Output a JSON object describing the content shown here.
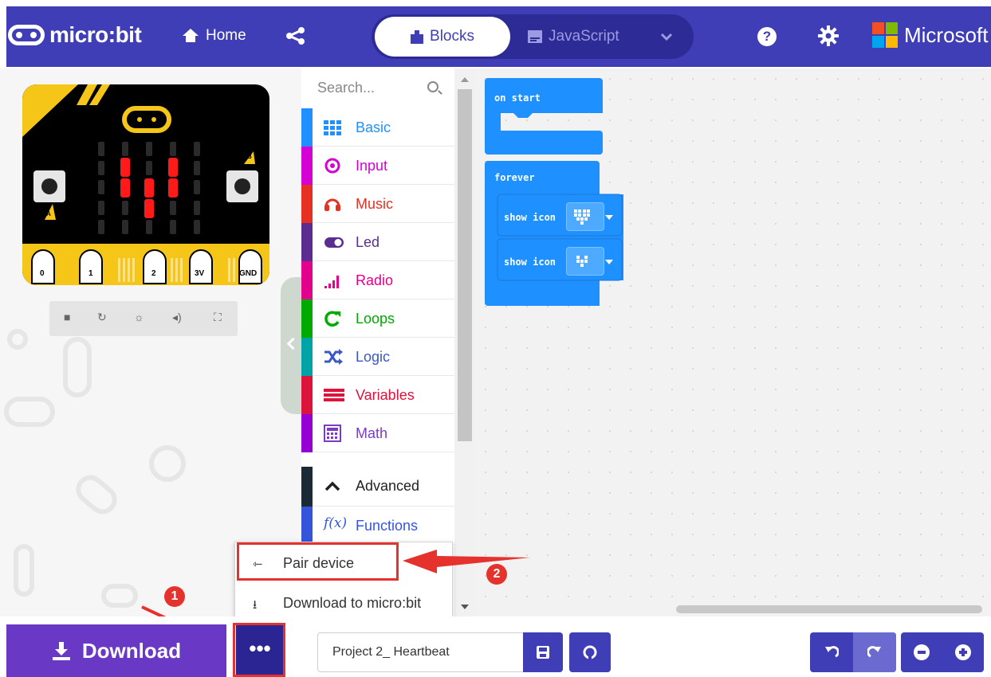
{
  "header": {
    "logo_text": "micro:bit",
    "home_label": "Home",
    "tabs": [
      {
        "label": "Blocks",
        "active": true
      },
      {
        "label": "JavaScript",
        "active": false
      }
    ],
    "brand_label": "Microsoft",
    "icons": [
      "microbit-logo-icon",
      "home-icon",
      "share-icon",
      "puzzle-icon",
      "code-icon",
      "chevron-down-icon",
      "help-icon",
      "gear-icon",
      "microsoft-logo-icon"
    ]
  },
  "simulator": {
    "pins": [
      "0",
      "1",
      "2",
      "3V",
      "GND"
    ],
    "button_a": "A",
    "button_b": "B",
    "controls": [
      "stop-icon",
      "restart-icon",
      "debug-icon",
      "mute-icon",
      "fullscreen-icon"
    ]
  },
  "toolbox": {
    "search_placeholder": "Search...",
    "categories": [
      {
        "label": "Basic",
        "color": "#1e90ff",
        "icon": "grid-icon"
      },
      {
        "label": "Input",
        "color": "#d400d4",
        "icon": "target-icon"
      },
      {
        "label": "Music",
        "color": "#e63022",
        "icon": "headphones-icon"
      },
      {
        "label": "Led",
        "color": "#5c2d91",
        "icon": "toggle-icon"
      },
      {
        "label": "Radio",
        "color": "#e3008c",
        "icon": "signal-bars-icon"
      },
      {
        "label": "Loops",
        "color": "#00aa00",
        "icon": "refresh-icon"
      },
      {
        "label": "Logic",
        "color": "#00a4a6",
        "icon": "shuffle-icon"
      },
      {
        "label": "Variables",
        "color": "#dc143c",
        "icon": "list-icon"
      },
      {
        "label": "Math",
        "color": "#9400d3",
        "icon": "calculator-icon"
      },
      {
        "label": "Advanced",
        "color": "#222222",
        "icon": "chevron-up-icon"
      },
      {
        "label": "Functions",
        "color": "#3455db",
        "icon": "function-icon"
      }
    ]
  },
  "workspace": {
    "blocks": {
      "on_start": "on start",
      "forever": "forever",
      "show_icon_1": "show icon",
      "show_icon_2": "show icon"
    }
  },
  "popup": {
    "items": [
      {
        "label": "Pair device",
        "icon": "usb-icon"
      },
      {
        "label": "Download to micro:bit",
        "icon": "download-icon"
      }
    ],
    "step_badges": [
      "1",
      "2"
    ]
  },
  "bottom": {
    "download_label": "Download",
    "more_label": "•••",
    "project_name": "Project 2_ Heartbeat",
    "icons": [
      "download-icon",
      "save-icon",
      "github-icon",
      "undo-icon",
      "redo-icon",
      "zoom-out-icon",
      "zoom-in-icon"
    ]
  },
  "colors": {
    "header": "#3f3eb6",
    "download": "#6938c4",
    "more": "#2a2593",
    "highlight": "#e5322d",
    "block": "#1e90ff"
  }
}
